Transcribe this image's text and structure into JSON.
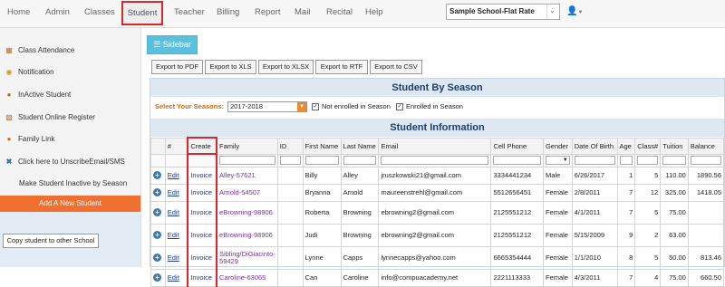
{
  "nav": {
    "items": [
      {
        "label": "Home"
      },
      {
        "label": "Admin"
      },
      {
        "label": "Classes"
      },
      {
        "label": "Student"
      },
      {
        "label": "Teacher"
      },
      {
        "label": "Billing"
      },
      {
        "label": "Report"
      },
      {
        "label": "Mail"
      },
      {
        "label": "Recital"
      },
      {
        "label": "Help"
      }
    ],
    "active": "Student",
    "school_select": "Sample School-Flat Rate",
    "user_icon": "user-icon"
  },
  "sidebar": {
    "items": [
      {
        "label": "Class Attendance",
        "icon": "calendar-icon"
      },
      {
        "label": "Notification",
        "icon": "bell-icon"
      },
      {
        "label": "InActive Student",
        "icon": "user-icon"
      },
      {
        "label": "Student Online Register",
        "icon": "register-icon"
      },
      {
        "label": "Family Link",
        "icon": "family-icon"
      },
      {
        "label": "Click here to UnscribeEmail/SMS",
        "icon": "close-icon"
      },
      {
        "label": "Make Student Inactive by Season",
        "icon": ""
      }
    ],
    "add_button": "Add A New Student",
    "copy_button": "Copy student to other School"
  },
  "toolbar": {
    "sidebar_button": "Sidebar",
    "exports": [
      "Export to PDF",
      "Export to XLS",
      "Export to XLSX",
      "Export to RTF",
      "Export to CSV"
    ]
  },
  "panel": {
    "title": "Student By Season",
    "season_label": "Select Your Seasons:",
    "season_value": "2017-2018",
    "not_enrolled_label": "Not enrolled in Season",
    "not_enrolled_checked": true,
    "enrolled_label": "Enrolled in Season",
    "enrolled_checked": true,
    "info_title": "Student Information"
  },
  "table": {
    "columns": [
      "",
      "#",
      "Create",
      "Family",
      "ID",
      "First Name",
      "Last Name",
      "Email",
      "Cell Phone",
      "Gender",
      "Date Of Birth",
      "Age",
      "Class#",
      "Tuition",
      "Balance"
    ],
    "rows": [
      {
        "edit": "Edit",
        "create": "Invoice",
        "family": "Alley-57621",
        "first": "Billy",
        "last": "Alley",
        "email": "jruszkowski21@gmail.com",
        "phone": "3334441234",
        "gender": "Male",
        "dob": "6/26/2017",
        "age": "1",
        "classes": "5",
        "tuition": "110.00",
        "balance": "1890.56"
      },
      {
        "edit": "Edit",
        "create": "Invoice",
        "family": "Arnold-54507",
        "first": "Bryanna",
        "last": "Arnold",
        "email": "maureenstrehl@gmail.com",
        "phone": "5512656451",
        "gender": "Female",
        "dob": "2/8/2011",
        "age": "7",
        "classes": "12",
        "tuition": "325.00",
        "balance": "1418.05"
      },
      {
        "edit": "Edit",
        "create": "Invoice",
        "family": "eBrowning-98906",
        "first": "Roberta",
        "last": "Browning",
        "email": "ebrowning2@gmail.com",
        "phone": "2125551212",
        "gender": "Female",
        "dob": "4/1/2011",
        "age": "7",
        "classes": "5",
        "tuition": "75.00",
        "balance": ""
      },
      {
        "edit": "Edit",
        "create": "Invoice",
        "family": "eBrowning-98906",
        "first": "Judi",
        "last": "Browning",
        "email": "ebrowning2@gmail.com",
        "phone": "2125551212",
        "gender": "Female",
        "dob": "5/15/2009",
        "age": "9",
        "classes": "2",
        "tuition": "63.00",
        "balance": ""
      },
      {
        "edit": "Edit",
        "create": "Invoice",
        "family": "Sibling/DiGiacinto-59429",
        "first": "Lynne",
        "last": "Capps",
        "email": "lynnecapps@yahoo.com",
        "phone": "6665354444",
        "gender": "Female",
        "dob": "1/1/2010",
        "age": "8",
        "classes": "5",
        "tuition": "50.00",
        "balance": "813.46"
      },
      {
        "edit": "Edit",
        "create": "Invoice",
        "family": "Caroline-63065",
        "first": "Can",
        "last": "Caroline",
        "email": "info@compuacademy.net",
        "phone": "2221113333",
        "gender": "Female",
        "dob": "4/3/2011",
        "age": "7",
        "classes": "4",
        "tuition": "75.00",
        "balance": "660.50"
      }
    ]
  }
}
